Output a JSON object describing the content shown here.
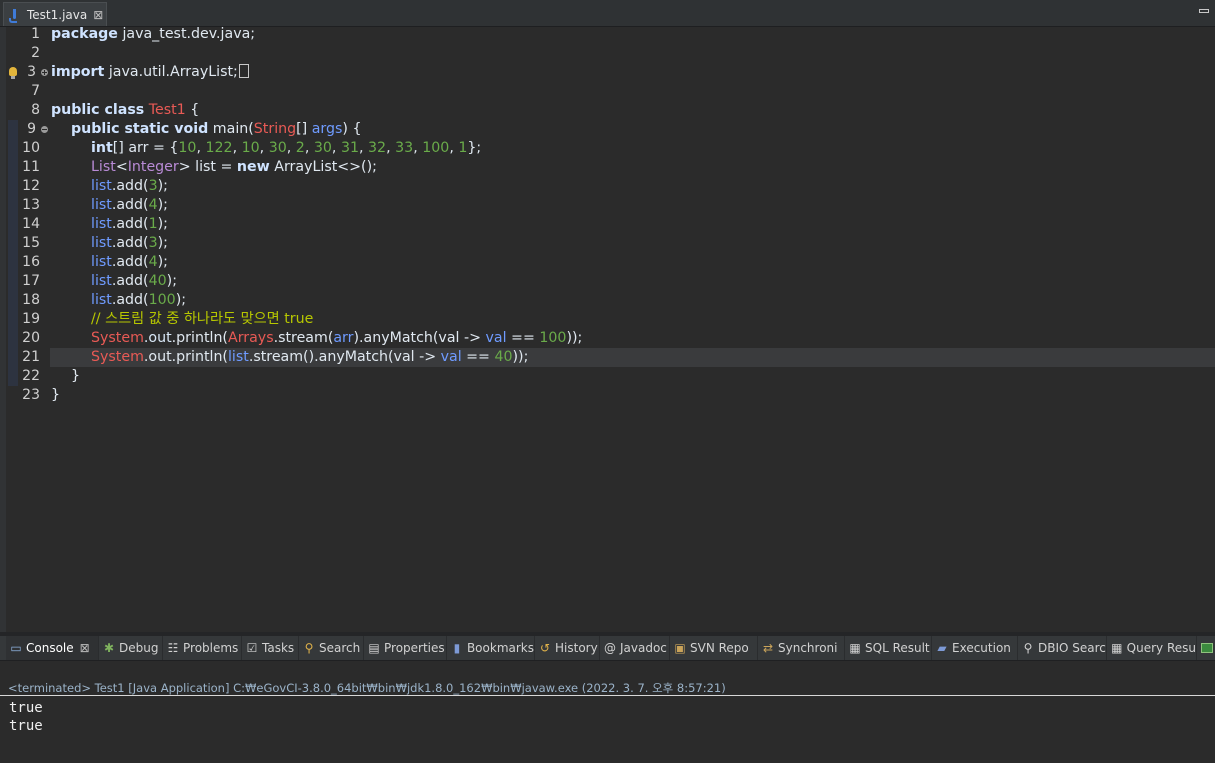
{
  "editor": {
    "tab_label": "Test1.java",
    "tab_close": "⊠",
    "lines": [
      {
        "n": "1"
      },
      {
        "n": "2"
      },
      {
        "n": "3"
      },
      {
        "n": "7"
      },
      {
        "n": "8"
      },
      {
        "n": "9"
      },
      {
        "n": "10"
      },
      {
        "n": "11"
      },
      {
        "n": "12"
      },
      {
        "n": "13"
      },
      {
        "n": "14"
      },
      {
        "n": "15"
      },
      {
        "n": "16"
      },
      {
        "n": "17"
      },
      {
        "n": "18"
      },
      {
        "n": "19"
      },
      {
        "n": "20"
      },
      {
        "n": "21"
      },
      {
        "n": "22"
      },
      {
        "n": "23"
      }
    ],
    "code": {
      "l1_kw": "package",
      "l1_rest": " java_test.dev.java;",
      "l3_kw": "import",
      "l3_rest": " java.util.ArrayList;",
      "l8_kw": "public class",
      "l8_cls": " Test1",
      "l8_rest": " {",
      "l9_kw": "public static void",
      "l9_fn": " main(",
      "l9_typ": "String",
      "l9_mid": "[] ",
      "l9_arg": "args",
      "l9_end": ") {",
      "l10_kw": "int",
      "l10_mid": "[] arr = {",
      "l10_nums": [
        "10",
        "122",
        "10",
        "30",
        "2",
        "30",
        "31",
        "32",
        "33",
        "100",
        "1"
      ],
      "l10_end": "};",
      "l11_typ": "List",
      "l11_lt": "<",
      "l11_int": "Integer",
      "l11_mid": "> list = ",
      "l11_kw": "new",
      "l11_end": " ArrayList<>();",
      "add_obj": "list",
      "add_call": ".add(",
      "add_vals": [
        "3",
        "4",
        "1",
        "3",
        "4",
        "40",
        "100"
      ],
      "add_end": ");",
      "l19_comment": "// 스트림 값 중 하나라도 맞으면 true",
      "l20_sys": "System",
      "l20_out": ".out",
      "l20_pr": ".println(",
      "l20_arrays": "Arrays",
      "l20_stream": ".stream(",
      "l20_arr": "arr",
      "l20_any": ").anyMatch(val -> ",
      "l20_val": "val",
      "l20_eq": " == ",
      "l20_num": "100",
      "l20_end": "));",
      "l21_list": "list",
      "l21_stream": ".stream().anyMatch(",
      "l21_lam": "val -> ",
      "l21_val": "val",
      "l21_eq": " == ",
      "l21_num": "40",
      "l21_end": "));",
      "l22": "}",
      "l23": "}"
    }
  },
  "views": {
    "tabs": [
      {
        "label": "Console",
        "icon": "▭"
      },
      {
        "label": "Debug",
        "icon": "✱"
      },
      {
        "label": "Problems",
        "icon": "☷"
      },
      {
        "label": "Tasks",
        "icon": "☑"
      },
      {
        "label": "Search",
        "icon": "⚲"
      },
      {
        "label": "Properties",
        "icon": "▤"
      },
      {
        "label": "Bookmarks",
        "icon": "▮"
      },
      {
        "label": "History",
        "icon": "↺"
      },
      {
        "label": "Javadoc",
        "icon": "@"
      },
      {
        "label": "SVN Repo",
        "icon": "▣"
      },
      {
        "label": "Synchroni",
        "icon": "⇄"
      },
      {
        "label": "SQL Result",
        "icon": "▦"
      },
      {
        "label": "Execution",
        "icon": "▰"
      },
      {
        "label": "DBIO Searc",
        "icon": "⚲"
      },
      {
        "label": "Query Resu",
        "icon": "▦"
      }
    ],
    "close_glyph": "⊠"
  },
  "console": {
    "header": "<terminated> Test1 [Java Application] C:₩eGovCI-3.8.0_64bit₩bin₩jdk1.8.0_162₩bin₩javaw.exe (2022. 3. 7. 오후 8:57:21)",
    "output": [
      "true",
      "true"
    ]
  }
}
